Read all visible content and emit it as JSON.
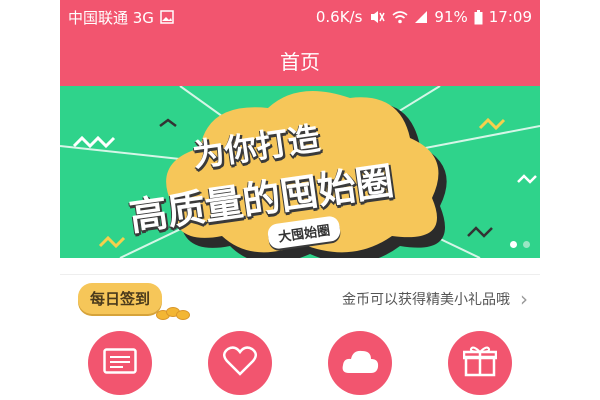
{
  "statusbar": {
    "carrier": "中国联通 3G",
    "speed": "0.6K/s",
    "battery": "91%",
    "time": "17:09"
  },
  "header": {
    "title": "首页"
  },
  "banner": {
    "line1": "为你打造",
    "line2": "高质量的囤始圈",
    "tag": "大囤始圈",
    "slides_total": 2,
    "active_slide": 1
  },
  "checkin": {
    "badge": "每日签到",
    "promo": "金币可以获得精美小礼品哦"
  },
  "quick_actions": [
    {
      "icon": "card-icon"
    },
    {
      "icon": "heart-icon"
    },
    {
      "icon": "cloud-icon"
    },
    {
      "icon": "gift-icon"
    }
  ],
  "colors": {
    "brand": "#f2556f",
    "banner_bg": "#2fd38b",
    "badge": "#f6c659"
  }
}
